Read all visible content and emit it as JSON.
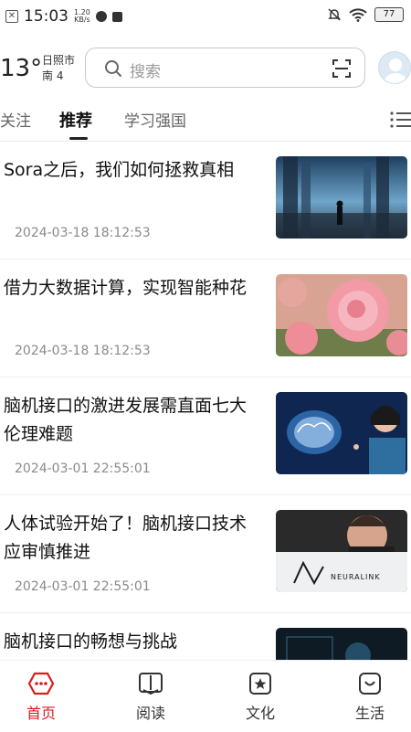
{
  "status_bar": {
    "time": "15:03",
    "speed_value": "1.20",
    "speed_unit": "KB/s",
    "battery": "77"
  },
  "header": {
    "temperature": "13°",
    "location": "日照市",
    "wind": "南 4",
    "search_placeholder": "搜索"
  },
  "tabs": [
    {
      "label": "关注"
    },
    {
      "label": "推荐",
      "active": true
    },
    {
      "label": "学习强国"
    }
  ],
  "feed": [
    {
      "title": "Sora之后，我们如何拯救真相",
      "date": "2024-03-18 18:12:53"
    },
    {
      "title": "借力大数据计算，实现智能种花",
      "date": "2024-03-18 18:12:53"
    },
    {
      "title": "脑机接口的激进发展需直面七大伦理难题",
      "date": "2024-03-01 22:55:01"
    },
    {
      "title": "人体试验开始了！脑机接口技术应审慎推进",
      "date": "2024-03-01 22:55:01"
    },
    {
      "title": "脑机接口的畅想与挑战",
      "date": ""
    }
  ],
  "thumb_texts": {
    "neuralink": "NEURALINK"
  },
  "bottom_nav": [
    {
      "label": "首页",
      "active": true
    },
    {
      "label": "阅读"
    },
    {
      "label": "文化"
    },
    {
      "label": "生活"
    }
  ],
  "colors": {
    "accent": "#d81e1e"
  }
}
